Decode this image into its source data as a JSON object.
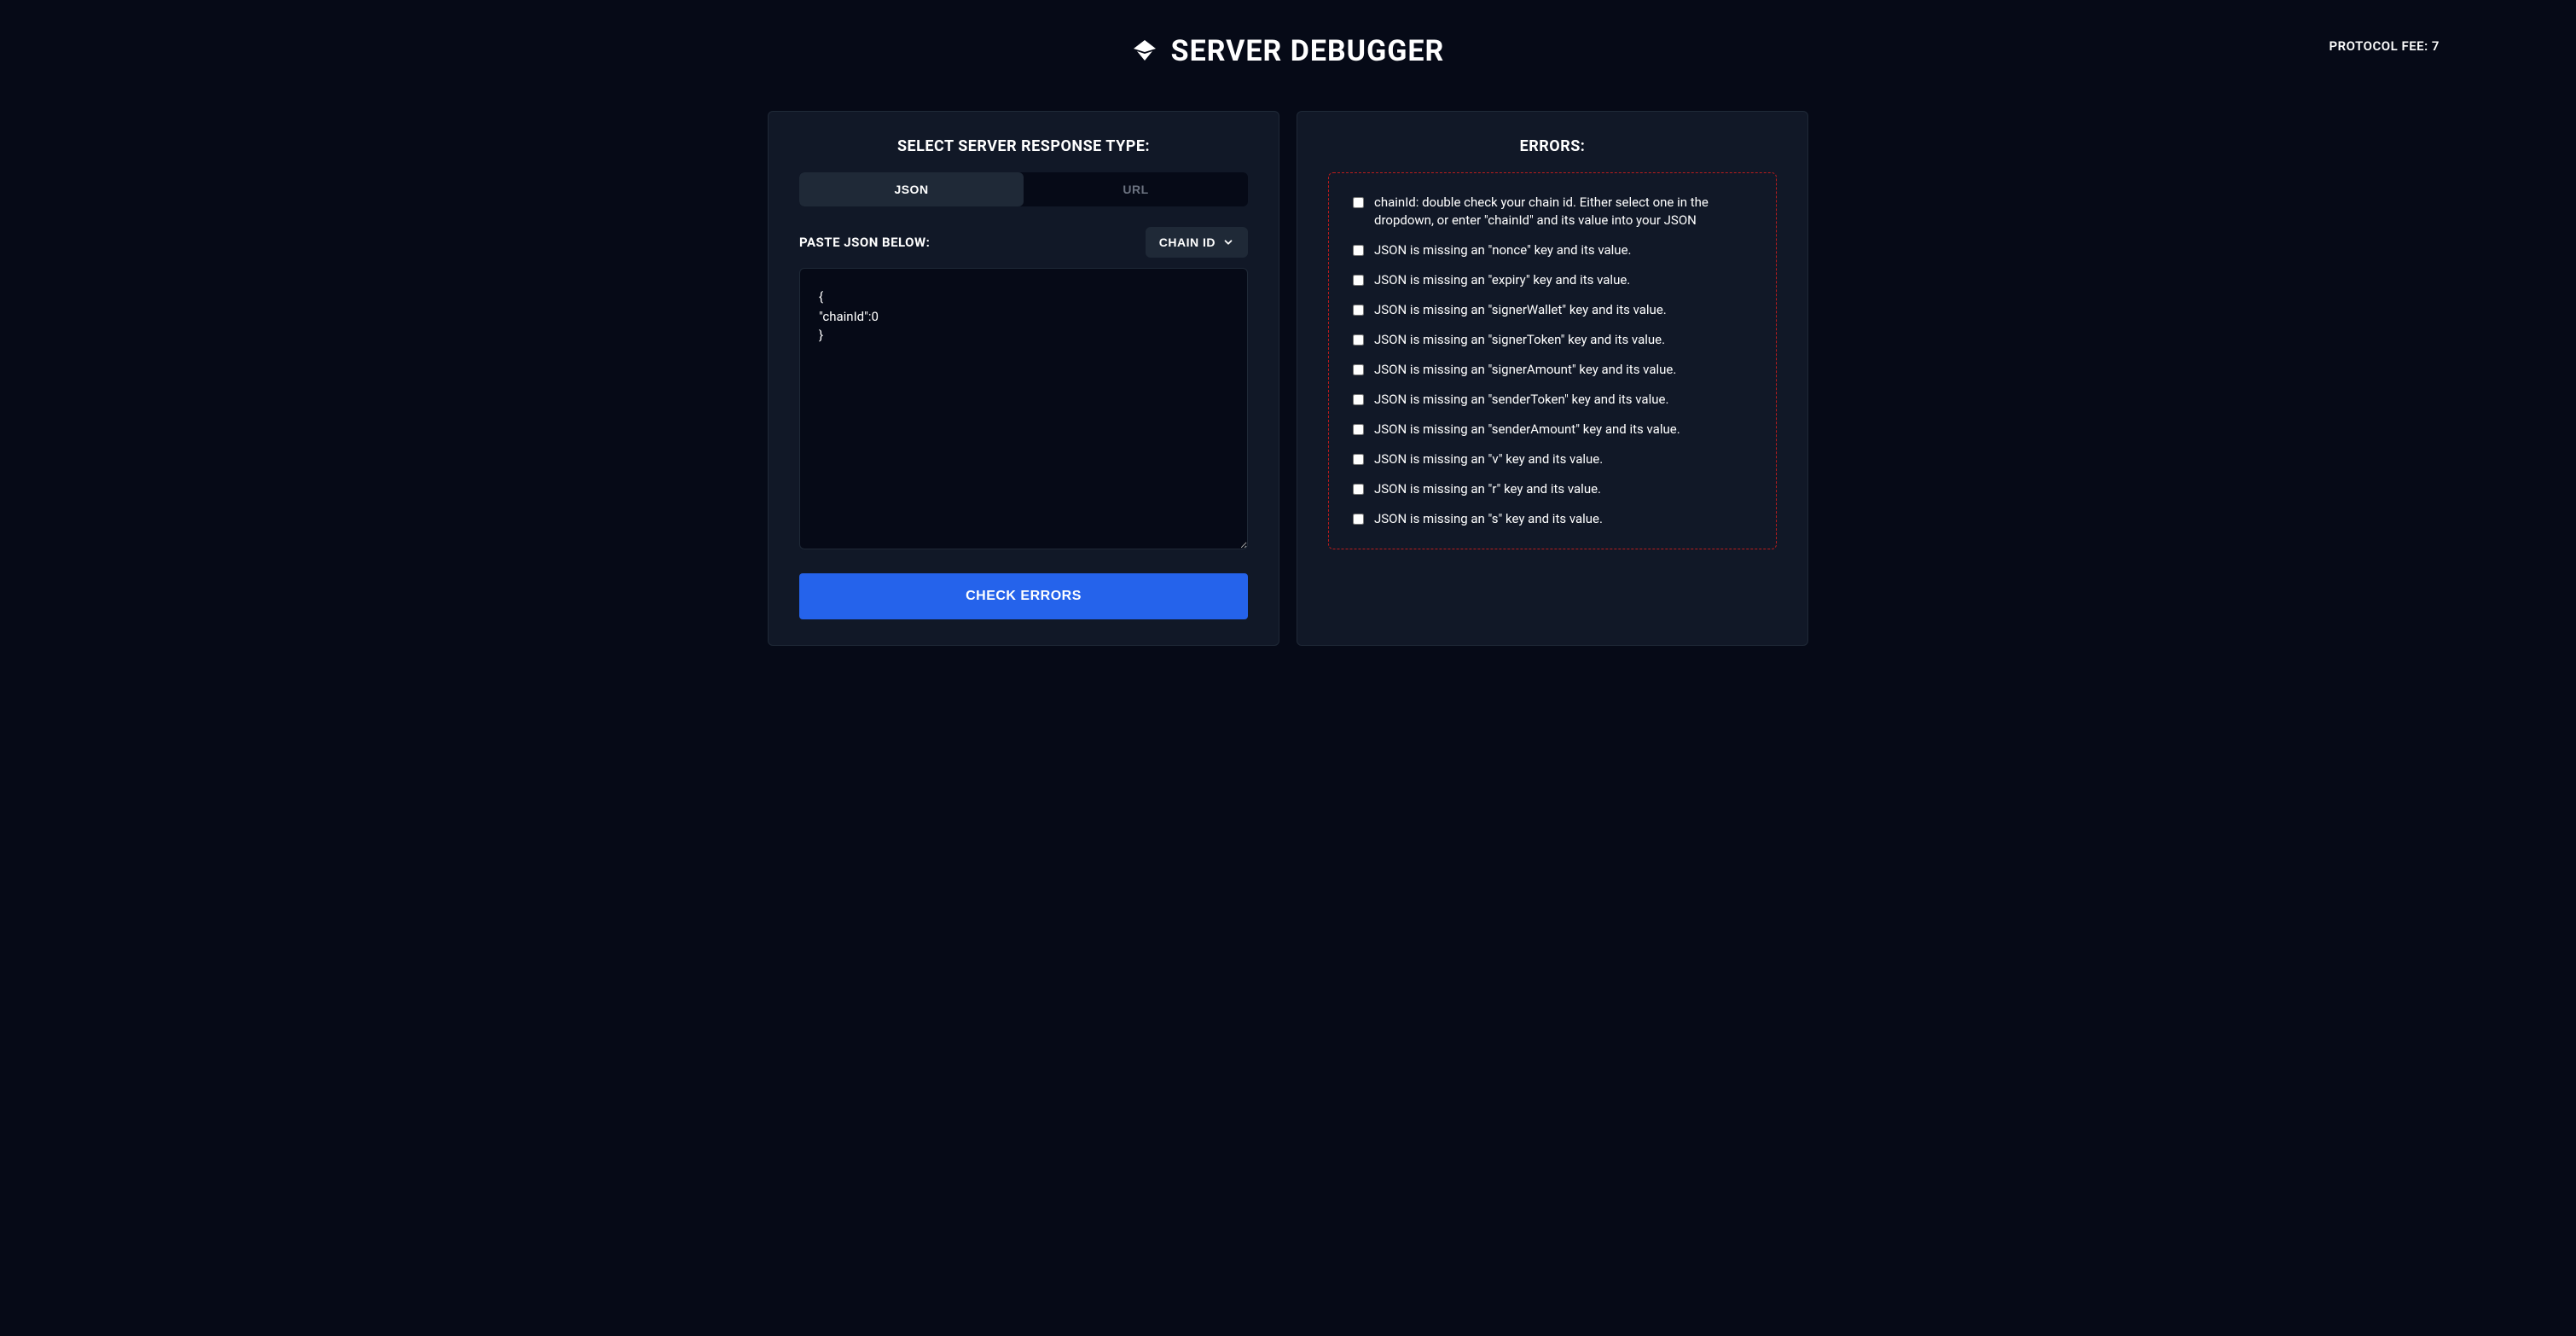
{
  "header": {
    "title": "SERVER DEBUGGER",
    "protocol_fee_label": "PROTOCOL FEE: 7"
  },
  "left_panel": {
    "title": "SELECT SERVER RESPONSE TYPE:",
    "toggle": {
      "json_label": "JSON",
      "url_label": "URL"
    },
    "input_label": "PASTE JSON BELOW:",
    "chain_dropdown_label": "CHAIN ID",
    "json_value": "{\n\"chainId\":0\n}",
    "check_button_label": "CHECK ERRORS"
  },
  "right_panel": {
    "title": "ERRORS:",
    "errors": [
      "chainId: double check your chain id. Either select one in the dropdown, or enter \"chainId\" and its value into your JSON",
      "JSON is missing an \"nonce\" key and its value.",
      "JSON is missing an \"expiry\" key and its value.",
      "JSON is missing an \"signerWallet\" key and its value.",
      "JSON is missing an \"signerToken\" key and its value.",
      "JSON is missing an \"signerAmount\" key and its value.",
      "JSON is missing an \"senderToken\" key and its value.",
      "JSON is missing an \"senderAmount\" key and its value.",
      "JSON is missing an \"v\" key and its value.",
      "JSON is missing an \"r\" key and its value.",
      "JSON is missing an \"s\" key and its value."
    ]
  }
}
